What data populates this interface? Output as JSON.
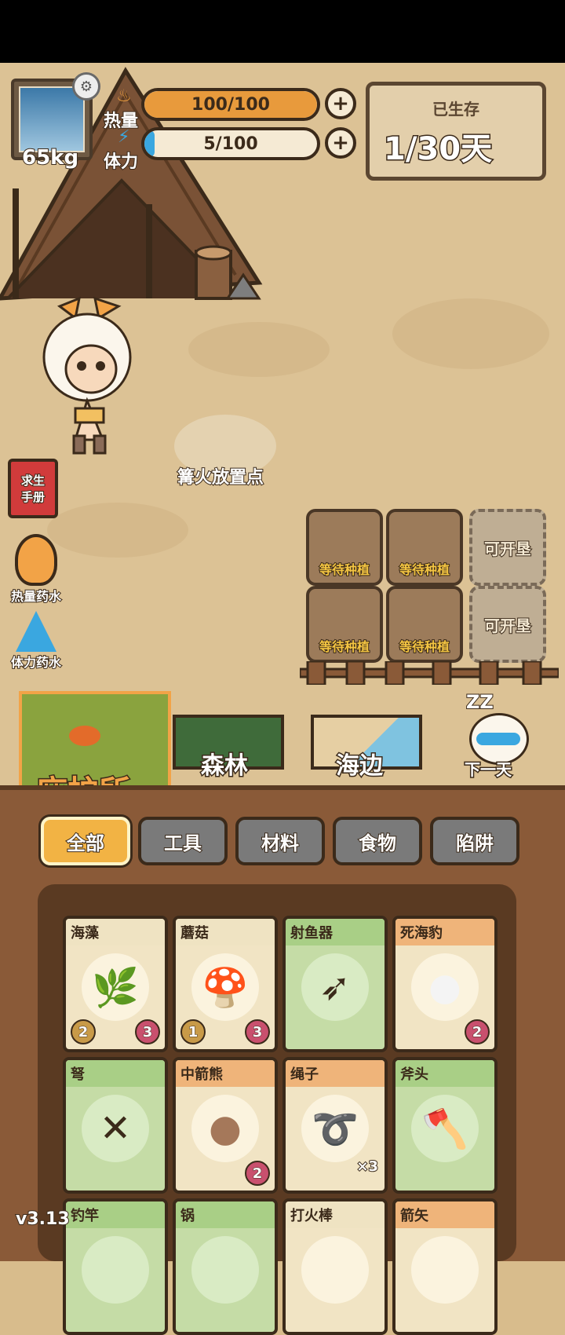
{
  "player": {
    "weight": "65kg",
    "heat_label": "热量",
    "heat_value": "100/100",
    "heat_fraction": 1.0,
    "stamina_label": "体力",
    "stamina_value": "5/100",
    "stamina_fraction": 0.05
  },
  "survival": {
    "title": "已生存",
    "days": "1/30天"
  },
  "side": {
    "handbook_line1": "求生",
    "handbook_line2": "手册",
    "heat_potion": "热量药水",
    "stamina_potion": "体力药水"
  },
  "campfire_label": "篝火放置点",
  "plots": [
    {
      "label": "等待种植"
    },
    {
      "label": "等待种植"
    },
    {
      "label": "可开垦"
    },
    {
      "label": "等待种植"
    },
    {
      "label": "等待种植"
    },
    {
      "label": "可开垦"
    }
  ],
  "locations": {
    "shelter": "庇护所",
    "forest": "森林",
    "seaside": "海边",
    "next_day": "下一天",
    "sleep_glyph": "ZZ"
  },
  "tabs": [
    "全部",
    "工具",
    "材料",
    "食物",
    "陷阱"
  ],
  "items": [
    {
      "name": "海藻",
      "left_badge": "2",
      "right_badge": "3",
      "head": "#efe3c2",
      "icon": "seaweed-icon"
    },
    {
      "name": "蘑菇",
      "left_badge": "1",
      "right_badge": "3",
      "head": "#efe3c2",
      "icon": "mushroom-icon"
    },
    {
      "name": "射鱼器",
      "left_badge": "",
      "right_badge": "",
      "head": "#a9cf86",
      "icon": "speargun-icon"
    },
    {
      "name": "死海豹",
      "left_badge": "",
      "right_badge": "2",
      "head": "#efb47a",
      "icon": "seal-icon"
    },
    {
      "name": "弩",
      "left_badge": "",
      "right_badge": "",
      "head": "#a9cf86",
      "icon": "crossbow-icon"
    },
    {
      "name": "中箭熊",
      "left_badge": "",
      "right_badge": "2",
      "head": "#efb47a",
      "icon": "bear-icon"
    },
    {
      "name": "绳子",
      "left_badge": "",
      "right_badge": "",
      "qty": "×3",
      "head": "#efb47a",
      "icon": "rope-icon"
    },
    {
      "name": "斧头",
      "left_badge": "",
      "right_badge": "",
      "head": "#a9cf86",
      "icon": "axe-icon"
    },
    {
      "name": "钓竿",
      "head": "#a9cf86",
      "icon": "rod-icon"
    },
    {
      "name": "锅",
      "head": "#a9cf86",
      "icon": "pot-icon"
    },
    {
      "name": "打火棒",
      "head": "#efe3c2",
      "icon": "firestarter-icon"
    },
    {
      "name": "箭矢",
      "head": "#efb47a",
      "icon": "arrow-icon"
    }
  ],
  "version": "v3.13",
  "colors": {
    "heat_fill": "#e89a3c",
    "stamina_fill": "#3aa7e0",
    "active_tab": "#f2b344",
    "shelter_label": "#f2a347"
  }
}
